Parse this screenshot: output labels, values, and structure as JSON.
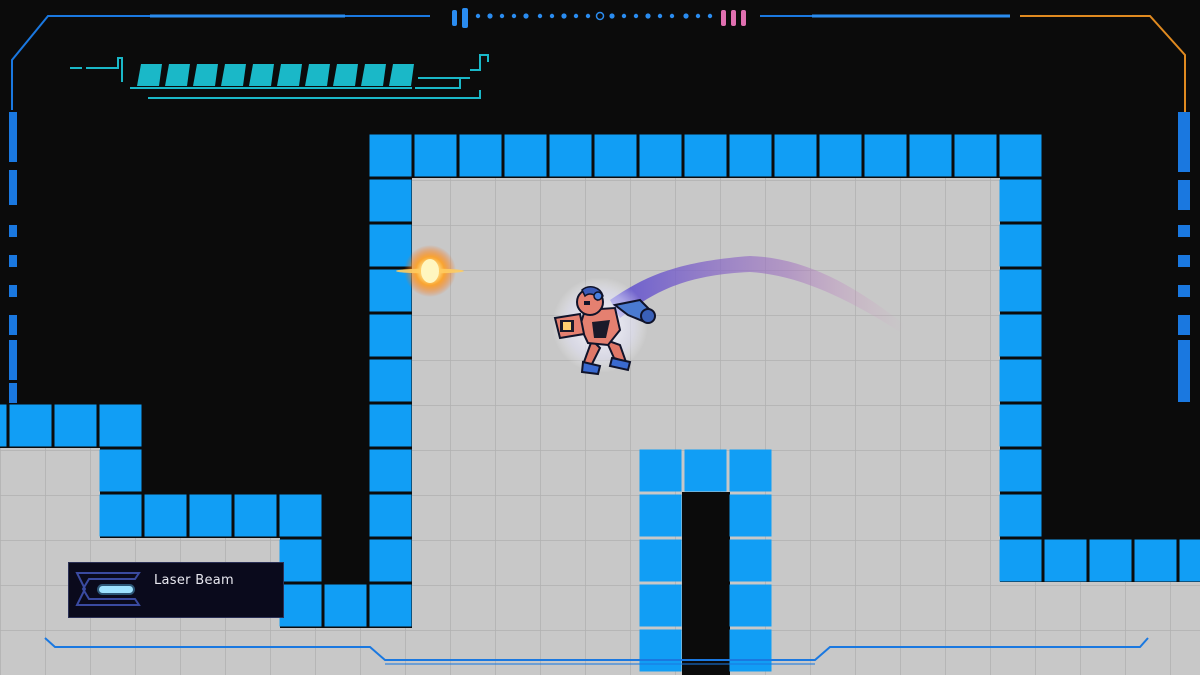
{
  "hud": {
    "health_segments_total": 10,
    "health_segments_filled": 10,
    "weapon": {
      "name": "Laser Beam",
      "icon": "laser-beam-icon"
    }
  },
  "colors": {
    "wall_block": "#119ef5",
    "floor": "#c8c8c8",
    "background": "#0b0b0b",
    "hud_cyan": "#1ab8c8",
    "hud_blue": "#1a78e0",
    "hud_orange": "#e08a20",
    "hud_pink": "#e070b0",
    "explosion": "#ffb020"
  }
}
